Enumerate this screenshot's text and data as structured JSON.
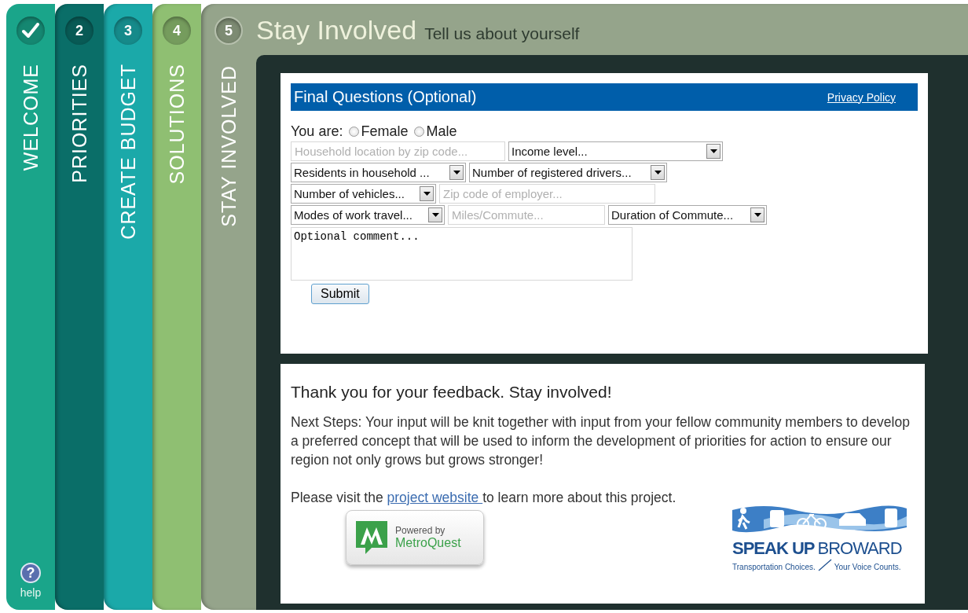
{
  "steps": [
    {
      "completed": true,
      "label": "WELCOME",
      "color": "#1aa58a",
      "selected": false
    },
    {
      "completed": false,
      "number": "2",
      "label": "PRIORITIES",
      "color": "#0a6e68",
      "selected": false
    },
    {
      "completed": false,
      "number": "3",
      "label": "CREATE BUDGET",
      "color": "#1ba9a9",
      "selected": false
    },
    {
      "completed": false,
      "number": "4",
      "label": "SOLUTIONS",
      "color": "#8fbf72",
      "selected": false
    },
    {
      "completed": false,
      "number": "5",
      "label": "STAY INVOLVED",
      "color": "#95a48b",
      "selected": true
    }
  ],
  "help": {
    "icon": "?",
    "label": "help"
  },
  "header": {
    "title": "Stay Involved",
    "subtitle": "Tell us about yourself"
  },
  "form": {
    "title": "Final Questions (Optional)",
    "privacy_link": "Privacy Policy",
    "gender": {
      "label": "You are:",
      "options": [
        {
          "label": "Female",
          "selected": false
        },
        {
          "label": "Male",
          "selected": false
        }
      ]
    },
    "rows": [
      [
        {
          "kind": "text",
          "placeholder": "Household location by zip code..."
        },
        {
          "kind": "select",
          "value": "Income level..."
        }
      ],
      [
        {
          "kind": "select",
          "value": "Residents in household ..."
        },
        {
          "kind": "select",
          "value": "Number of registered drivers..."
        }
      ],
      [
        {
          "kind": "select",
          "value": "Number of vehicles..."
        },
        {
          "kind": "text",
          "placeholder": "Zip code of employer..."
        }
      ],
      [
        {
          "kind": "select",
          "value": "Modes of work travel..."
        },
        {
          "kind": "text",
          "placeholder": "Miles/Commute..."
        },
        {
          "kind": "select",
          "value": "Duration of Commute..."
        }
      ]
    ],
    "comment": {
      "value": "Optional comment..."
    },
    "submit": "Submit"
  },
  "thanks": {
    "heading": "Thank you for your feedback. Stay involved!",
    "paragraph": "Next Steps: Your input will be knit together with input from your fellow community members to develop a preferred concept that will be used to inform the development of priorities for action to ensure our region not only grows but grows stronger!",
    "visit": {
      "before": "Please visit the ",
      "link": "project website ",
      "after": "to learn more about this project."
    }
  },
  "metroquest": {
    "powered": "Powered by",
    "name": "MetroQuest"
  },
  "speakup": {
    "bold": "SPEAK UP",
    "rest": "BROWARD",
    "tagline_left": "Transportation Choices.",
    "tagline_right": "Your Voice Counts."
  }
}
